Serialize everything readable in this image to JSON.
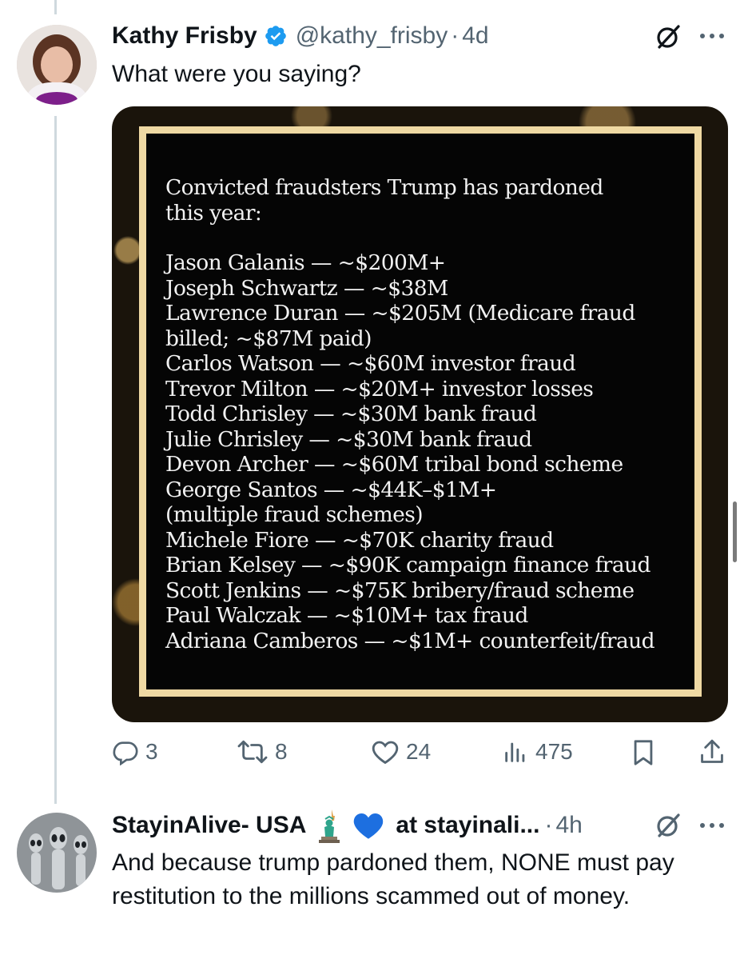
{
  "tweet1": {
    "display_name": "Kathy Frisby",
    "handle": "@kathy_frisby",
    "separator": "·",
    "time": "4d",
    "text": "What were you saying?",
    "image": {
      "title": "Convicted fraudsters Trump has pardoned this year:",
      "lines": [
        "Jason Galanis — ~$200M+",
        "Joseph Schwartz — ~$38M",
        "Lawrence Duran — ~$205M (Medicare fraud billed; ~$87M paid)",
        "Carlos Watson — ~$60M investor fraud",
        "Trevor Milton — ~$20M+ investor losses",
        "Todd Chrisley — ~$30M bank fraud",
        "Julie Chrisley — ~$30M bank fraud",
        "Devon Archer — ~$60M tribal bond scheme",
        "George Santos — ~$44K–$1M+ (multiple fraud schemes)",
        "Michele Fiore — ~$70K charity fraud",
        "Brian Kelsey — ~$90K campaign finance fraud",
        "Scott Jenkins — ~$75K bribery/fraud scheme",
        "Paul Walczak — ~$10M+ tax fraud",
        "Adriana Camberos — ~$1M+ counterfeit/fraud"
      ]
    },
    "actions": {
      "replies": "3",
      "reposts": "8",
      "likes": "24",
      "views": "475"
    }
  },
  "tweet2": {
    "display_name": "StayinAlive- USA",
    "name_suffix": "at stayinali...",
    "separator": "·",
    "time": "4h",
    "text": "And because trump pardoned them, NONE must pay restitution to the millions scammed out of money."
  },
  "icons": {
    "verified": "verified-badge-icon",
    "grok": "grok-icon",
    "more": "more-icon",
    "reply": "reply-icon",
    "repost": "repost-icon",
    "like": "like-icon",
    "views": "views-icon",
    "bookmark": "bookmark-icon",
    "share": "share-icon",
    "statue": "statue-of-liberty-icon",
    "heart": "blue-heart-icon"
  },
  "colors": {
    "verified": "#1d9bf0",
    "blue_heart": "#1d6fe0",
    "muted": "#536471",
    "frame": "#efd9a3"
  }
}
